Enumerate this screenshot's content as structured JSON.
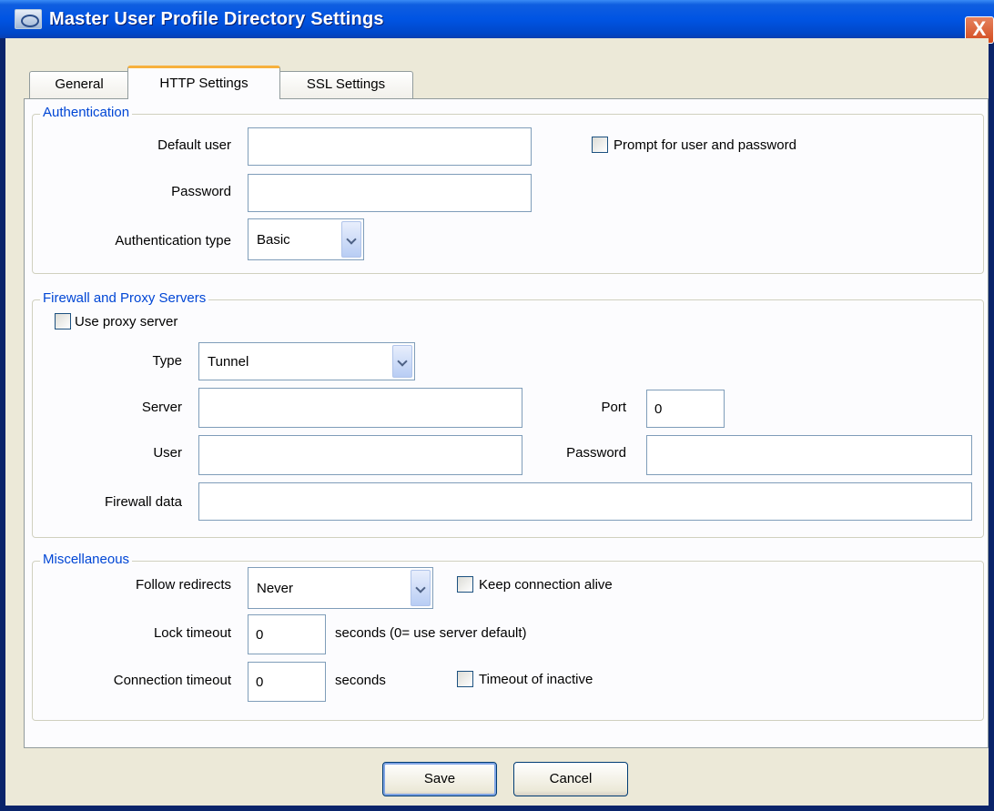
{
  "window": {
    "title": "Master User Profile Directory Settings",
    "close_glyph": "X"
  },
  "tabs": [
    {
      "label": "General",
      "active": false
    },
    {
      "label": "HTTP Settings",
      "active": true
    },
    {
      "label": "SSL Settings",
      "active": false
    }
  ],
  "authentication": {
    "legend": "Authentication",
    "default_user_label": "Default user",
    "default_user_value": "",
    "password_label": "Password",
    "password_value": "",
    "auth_type_label": "Authentication type",
    "auth_type_value": "Basic",
    "prompt_label": "Prompt for user and password",
    "prompt_checked": false
  },
  "firewall": {
    "legend": "Firewall and Proxy Servers",
    "use_proxy_label": "Use proxy server",
    "use_proxy_checked": false,
    "type_label": "Type",
    "type_value": "Tunnel",
    "server_label": "Server",
    "server_value": "",
    "port_label": "Port",
    "port_value": "0",
    "user_label": "User",
    "user_value": "",
    "password_label": "Password",
    "password_value": "",
    "firewall_data_label": "Firewall data",
    "firewall_data_value": ""
  },
  "misc": {
    "legend": "Miscellaneous",
    "follow_redirects_label": "Follow redirects",
    "follow_redirects_value": "Never",
    "keep_alive_label": "Keep connection alive",
    "keep_alive_checked": false,
    "lock_timeout_label": "Lock timeout",
    "lock_timeout_value": "0",
    "lock_timeout_suffix": "seconds  (0= use server default)",
    "conn_timeout_label": "Connection timeout",
    "conn_timeout_value": "0",
    "conn_timeout_suffix": "seconds",
    "timeout_inactive_label": "Timeout of inactive",
    "timeout_inactive_checked": false
  },
  "buttons": {
    "save": "Save",
    "cancel": "Cancel"
  },
  "colors": {
    "title_bar": "#0054e3",
    "legend_text": "#0046d5",
    "tab_highlight": "#f6b13d"
  }
}
